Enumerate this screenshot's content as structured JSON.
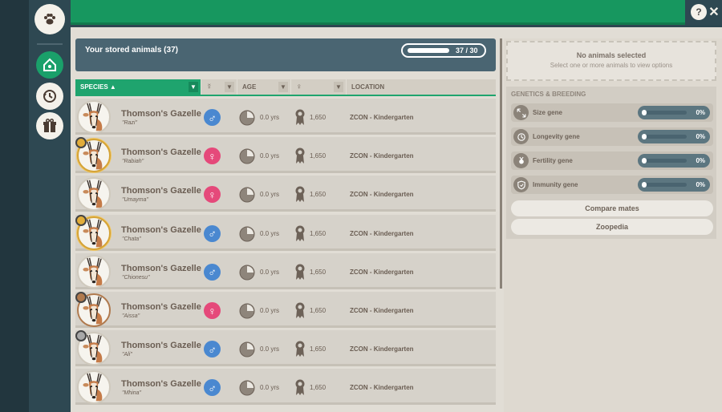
{
  "stored_panel": {
    "title": "Your stored animals (37)",
    "capacity_text": "37 / 30",
    "capacity_fill": 1.0
  },
  "columns": {
    "species": "SPECIES ▲",
    "sex_icon": "☿",
    "age": "AGE",
    "fertility_icon": "♀",
    "location": "LOCATION",
    "filter_icon": "▼"
  },
  "animals": [
    {
      "species": "Thomson's Gazelle",
      "name": "\"Razi\"",
      "sex": "male",
      "sex_symbol": "♂",
      "age": "0.0 yrs",
      "fertility": "1,650",
      "location": "ZCON - Kindergarten",
      "medal": "none"
    },
    {
      "species": "Thomson's Gazelle",
      "name": "\"Rabiah\"",
      "sex": "female",
      "sex_symbol": "♀",
      "age": "0.0 yrs",
      "fertility": "1,650",
      "location": "ZCON - Kindergarten",
      "medal": "gold"
    },
    {
      "species": "Thomson's Gazelle",
      "name": "\"Umayma\"",
      "sex": "female",
      "sex_symbol": "♀",
      "age": "0.0 yrs",
      "fertility": "1,650",
      "location": "ZCON - Kindergarten",
      "medal": "none"
    },
    {
      "species": "Thomson's Gazelle",
      "name": "\"Chata\"",
      "sex": "male",
      "sex_symbol": "♂",
      "age": "0.0 yrs",
      "fertility": "1,650",
      "location": "ZCON - Kindergarten",
      "medal": "gold"
    },
    {
      "species": "Thomson's Gazelle",
      "name": "\"Chionesu\"",
      "sex": "male",
      "sex_symbol": "♂",
      "age": "0.0 yrs",
      "fertility": "1,650",
      "location": "ZCON - Kindergarten",
      "medal": "none"
    },
    {
      "species": "Thomson's Gazelle",
      "name": "\"Aissa\"",
      "sex": "female",
      "sex_symbol": "♀",
      "age": "0.0 yrs",
      "fertility": "1,650",
      "location": "ZCON - Kindergarten",
      "medal": "bronze"
    },
    {
      "species": "Thomson's Gazelle",
      "name": "\"Ali\"",
      "sex": "male",
      "sex_symbol": "♂",
      "age": "0.0 yrs",
      "fertility": "1,650",
      "location": "ZCON - Kindergarten",
      "medal": "silver"
    },
    {
      "species": "Thomson's Gazelle",
      "name": "\"Mhina\"",
      "sex": "male",
      "sex_symbol": "♂",
      "age": "0.0 yrs",
      "fertility": "1,650",
      "location": "ZCON - Kindergarten",
      "medal": "none"
    }
  ],
  "selection": {
    "title": "No animals selected",
    "subtitle": "Select one or more animals to view options"
  },
  "genetics": {
    "title": "GENETICS & BREEDING",
    "genes": [
      {
        "label": "Size gene",
        "value": "0%",
        "icon": "size-icon"
      },
      {
        "label": "Longevity gene",
        "value": "0%",
        "icon": "clock-icon"
      },
      {
        "label": "Fertility gene",
        "value": "0%",
        "icon": "fertility-icon"
      },
      {
        "label": "Immunity gene",
        "value": "0%",
        "icon": "shield-icon"
      }
    ],
    "compare_button": "Compare mates",
    "zoopedia_button": "Zoopedia"
  },
  "topbar": {
    "help_label": "?",
    "close_label": "✕"
  },
  "colors": {
    "accent_green": "#1fa46e",
    "male_blue": "#4a88d0",
    "female_pink": "#e5497a",
    "header_slate": "#4a6572"
  }
}
